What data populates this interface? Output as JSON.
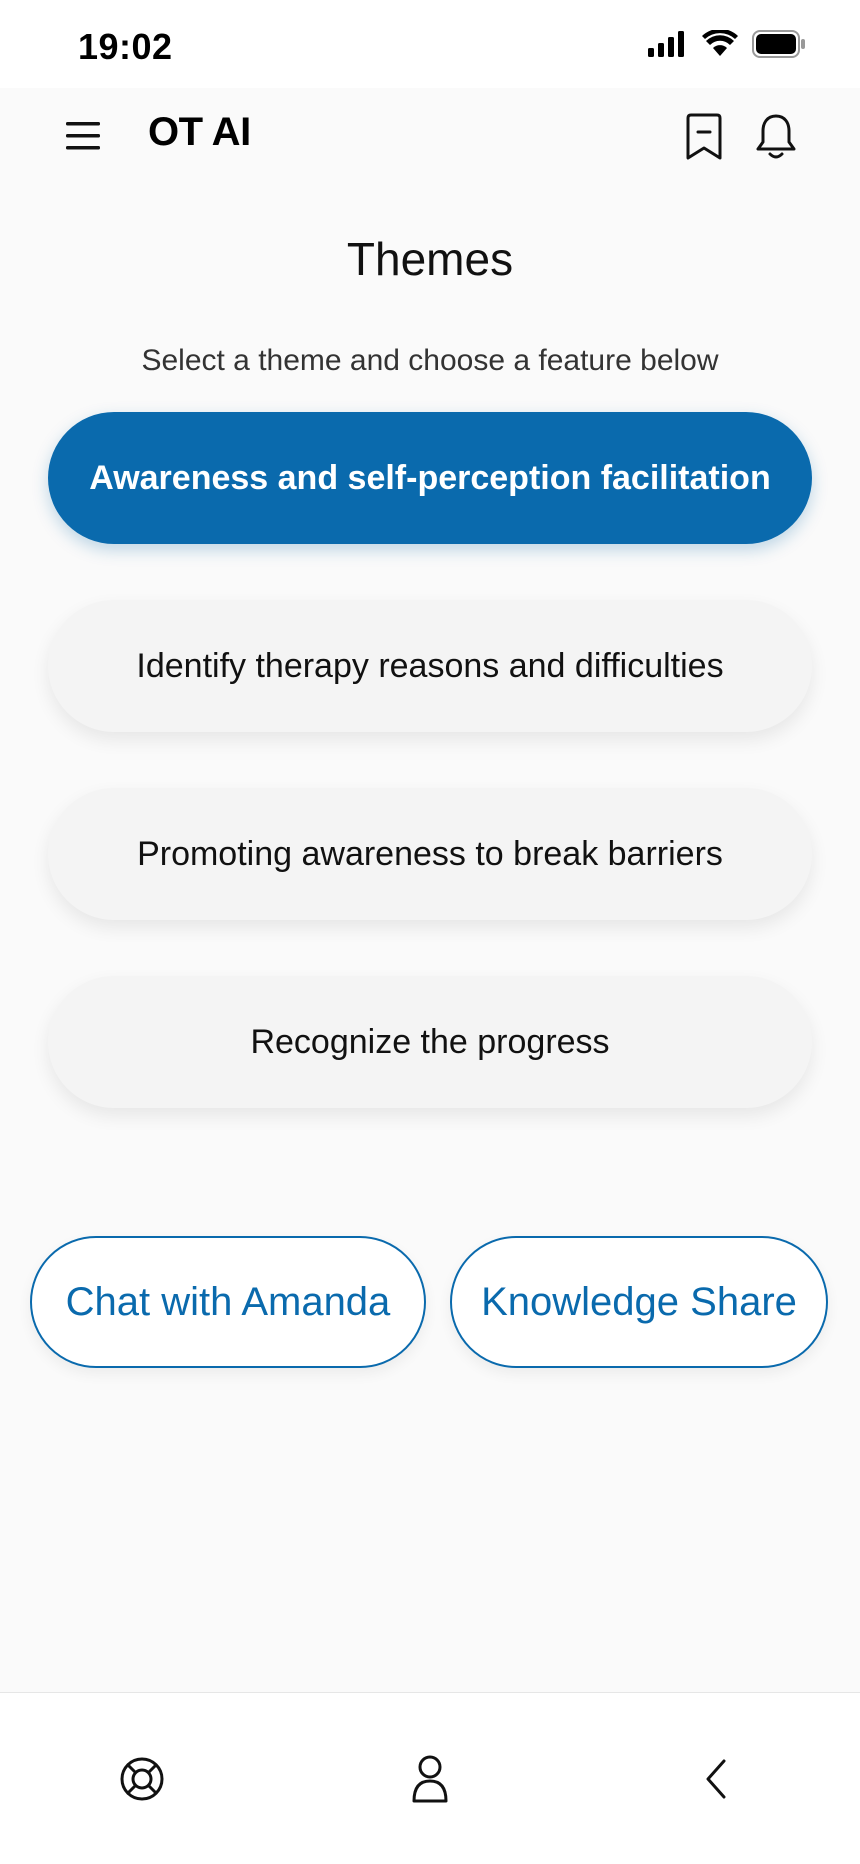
{
  "status_bar": {
    "time": "19:02",
    "icons": [
      "signal-icon",
      "wifi-icon",
      "battery-icon"
    ]
  },
  "header": {
    "app_title": "OT AI",
    "icons": [
      "menu-icon",
      "bookmark-icon",
      "bell-icon"
    ]
  },
  "main": {
    "title": "Themes",
    "subtitle": "Select a theme and choose a feature below",
    "themes": [
      {
        "label": "Awareness and self-perception facilitation",
        "selected": true
      },
      {
        "label": "Identify therapy reasons and difficulties",
        "selected": false
      },
      {
        "label": "Promoting awareness to break barriers",
        "selected": false
      },
      {
        "label": "Recognize the progress",
        "selected": false
      }
    ],
    "actions": [
      {
        "label": "Chat with Amanda"
      },
      {
        "label": "Knowledge Share"
      }
    ]
  },
  "bottom_nav": {
    "icons": [
      "lifebuoy-icon",
      "profile-icon",
      "back-chevron-icon"
    ]
  },
  "colors": {
    "accent": "#0a6aad",
    "background": "#fafafa",
    "theme_button_bg": "#f4f4f4"
  }
}
